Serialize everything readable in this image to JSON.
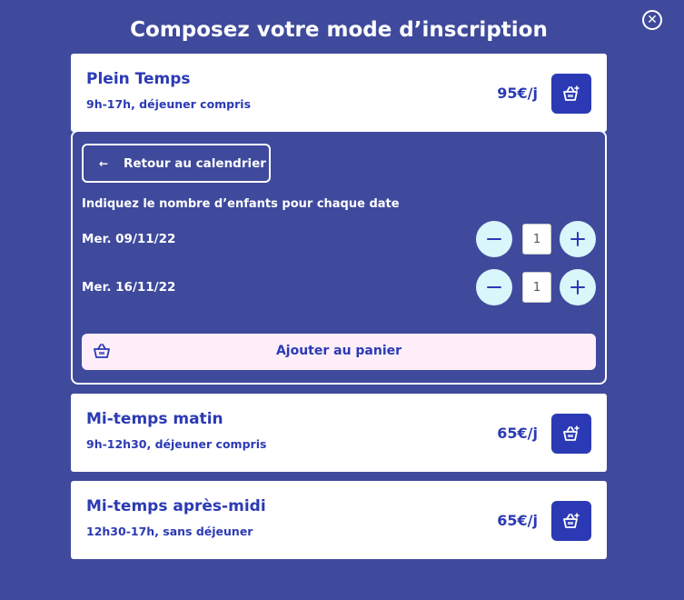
{
  "modal": {
    "title": "Composez votre mode d’inscription",
    "close_icon": "close-circle-icon"
  },
  "options": [
    {
      "name": "Plein Temps",
      "hours": "9h-17h, déjeuner compris",
      "price": "95€/j",
      "icon": "basket-add-icon"
    },
    {
      "name": "Mi-temps matin",
      "hours": "9h-12h30, déjeuner compris",
      "price": "65€/j",
      "icon": "basket-add-icon"
    },
    {
      "name": "Mi-temps après-midi",
      "hours": "12h30-17h, sans déjeuner",
      "price": "65€/j",
      "icon": "basket-add-icon"
    }
  ],
  "panel": {
    "back_label": "Retour au calendrier",
    "back_icon": "arrow-left-icon",
    "instruction": "Indiquez le nombre d’enfants pour chaque date",
    "dates": [
      {
        "label": "Mer. 09/11/22",
        "quantity": "1"
      },
      {
        "label": "Mer. 16/11/22",
        "quantity": "1"
      }
    ],
    "add_to_cart_label": "Ajouter au panier",
    "add_to_cart_icon": "basket-icon"
  },
  "colors": {
    "background": "#3f4a9c",
    "primary": "#2b3ab4",
    "card": "#ffffff",
    "stepper": "#d9f6fb",
    "cart_button": "#fdeefa"
  }
}
